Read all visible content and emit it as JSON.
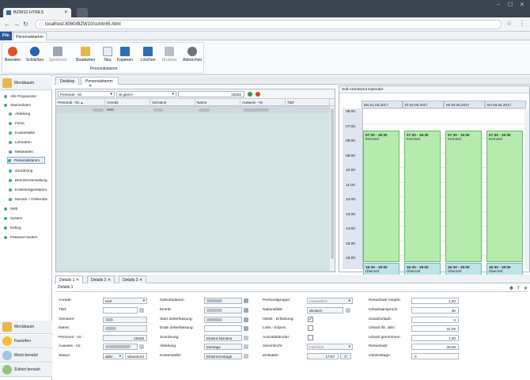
{
  "browser": {
    "tab_title": "BZW10 HTML5",
    "url": "localhost:8080/BZW10/schtml5.html"
  },
  "ribbon": {
    "tabs": [
      "File",
      "Personalstamm"
    ],
    "buttons": [
      "Beenden",
      "Schließen",
      "Speichern",
      "Bearbeiten",
      "Neu",
      "Kopieren",
      "Löschen",
      "Drucken",
      "Abbrechen"
    ],
    "group_label": "Personalstamm"
  },
  "nav": {
    "header": "Menübaum",
    "items": [
      "Alle Programme",
      "Stammdaten",
      "Abteilung",
      "Firma",
      "Kostenstelle",
      "Lohnarten",
      "Meldearten",
      "Personalstamm",
      "Zuordnung",
      "Benutzerverwaltung",
      "Kostenträgerstamm",
      "Monats- / Fehlerübe",
      "Web",
      "System",
      "Debug",
      "Passwort ändern"
    ],
    "footer": [
      "Menübaum",
      "Favoriten",
      "Meist benutzt",
      "Zuletzt benutzt"
    ]
  },
  "main_tabs": [
    "Desktop",
    "Personalstamm"
  ],
  "grid": {
    "filter_field": "Personal - Nr.",
    "filter_op": "ist gleich",
    "filter_value": "10020",
    "columns": [
      "Personal - Nr.",
      "Anrede",
      "Vorname",
      "Name",
      "Ausweis - Nr.",
      "Titel"
    ],
    "row": {
      "anrede": "Herr"
    }
  },
  "calendar": {
    "title": "Soll-Arbeitszeit Kalender",
    "days": [
      "Mo 01.05.2017",
      "Di 02.05.2017",
      "Mi 03.05.2017",
      "Do 04.05.2017"
    ],
    "times": [
      "06:00",
      "07:00",
      "08:00",
      "09:00",
      "10:00",
      "11:00",
      "12:00",
      "13:00",
      "14:00",
      "15:00",
      "16:00"
    ],
    "appt_core": "07:30 - 16:30",
    "appt_core_label": "Kernzeit",
    "appt_over": "16:30 - 18:00",
    "appt_over_label": "Überzeit"
  },
  "details": {
    "tabs": [
      "Details 1",
      "Details 2",
      "Details 3"
    ],
    "title": "Details 1",
    "col1": {
      "labels": [
        "Anrede:",
        "Titel:",
        "Vorname:",
        "Name:",
        "Personal - Nr.:",
        "Ausweis - Nr.:",
        "Status:"
      ],
      "anrede": "Herr",
      "personal_nr": "10020",
      "status": "aktiv",
      "status2": "abwesend"
    },
    "col2": {
      "labels": [
        "Geburtsdatum:",
        "Eintritt:",
        "Start Zeiterfassung:",
        "Ende Zeiterfassung:",
        "Zuordnung:",
        "Abteilung:",
        "Kostenstelle:"
      ],
      "zuordnung": "Elektro-Monteur",
      "abteilung": "Montage",
      "kostenstelle": "Elektromontage"
    },
    "col3": {
      "labels": [
        "Personalgruppe:",
        "Nationalität:",
        "Istzeit - Erfassung:",
        "Lohn - Export:",
        "Auszubildender:",
        "Geschlecht:",
        "Zeitsaldo:"
      ],
      "gruppe": "Gewerblich",
      "nation": "deutsch",
      "geschlecht": "männlich",
      "zeitsaldo": "17:07",
      "c": "C"
    },
    "col4": {
      "labels": [
        "Resturlaub Vorjahr:",
        "Urlaubsanspruch:",
        "Zusatzurlaub:",
        "Urlaub lfd. Jahr:",
        "Urlaub genommen:",
        "Resturlaub:",
        "Gleitzeittage:"
      ],
      "values": [
        "1,00",
        "30",
        "0",
        "31,00",
        "1,00",
        "30,00",
        "0"
      ]
    }
  }
}
